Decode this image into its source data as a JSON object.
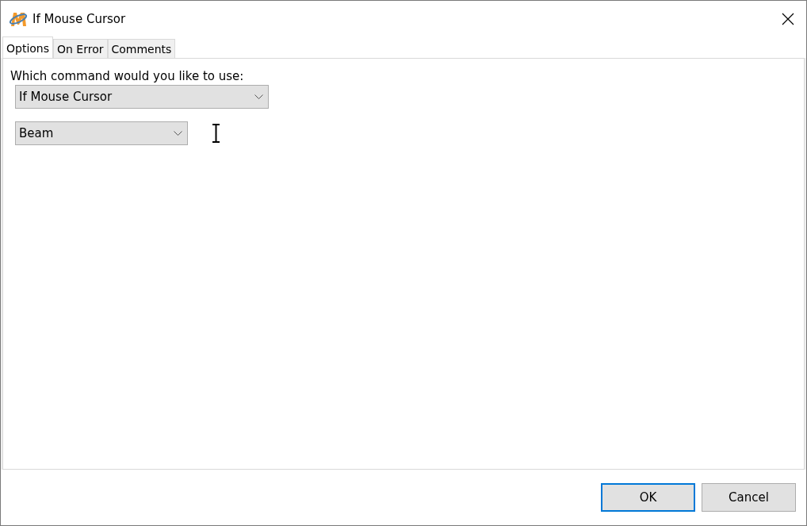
{
  "window": {
    "title": "If Mouse Cursor"
  },
  "tabs": [
    {
      "label": "Options",
      "selected": true
    },
    {
      "label": "On Error",
      "selected": false
    },
    {
      "label": "Comments",
      "selected": false
    }
  ],
  "prompt": "Which command would you like to use:",
  "command_dropdown": {
    "value": "If Mouse Cursor"
  },
  "cursor_dropdown": {
    "value": "Beam"
  },
  "buttons": [
    {
      "label": "OK",
      "default": true
    },
    {
      "label": "Cancel",
      "default": false
    }
  ]
}
